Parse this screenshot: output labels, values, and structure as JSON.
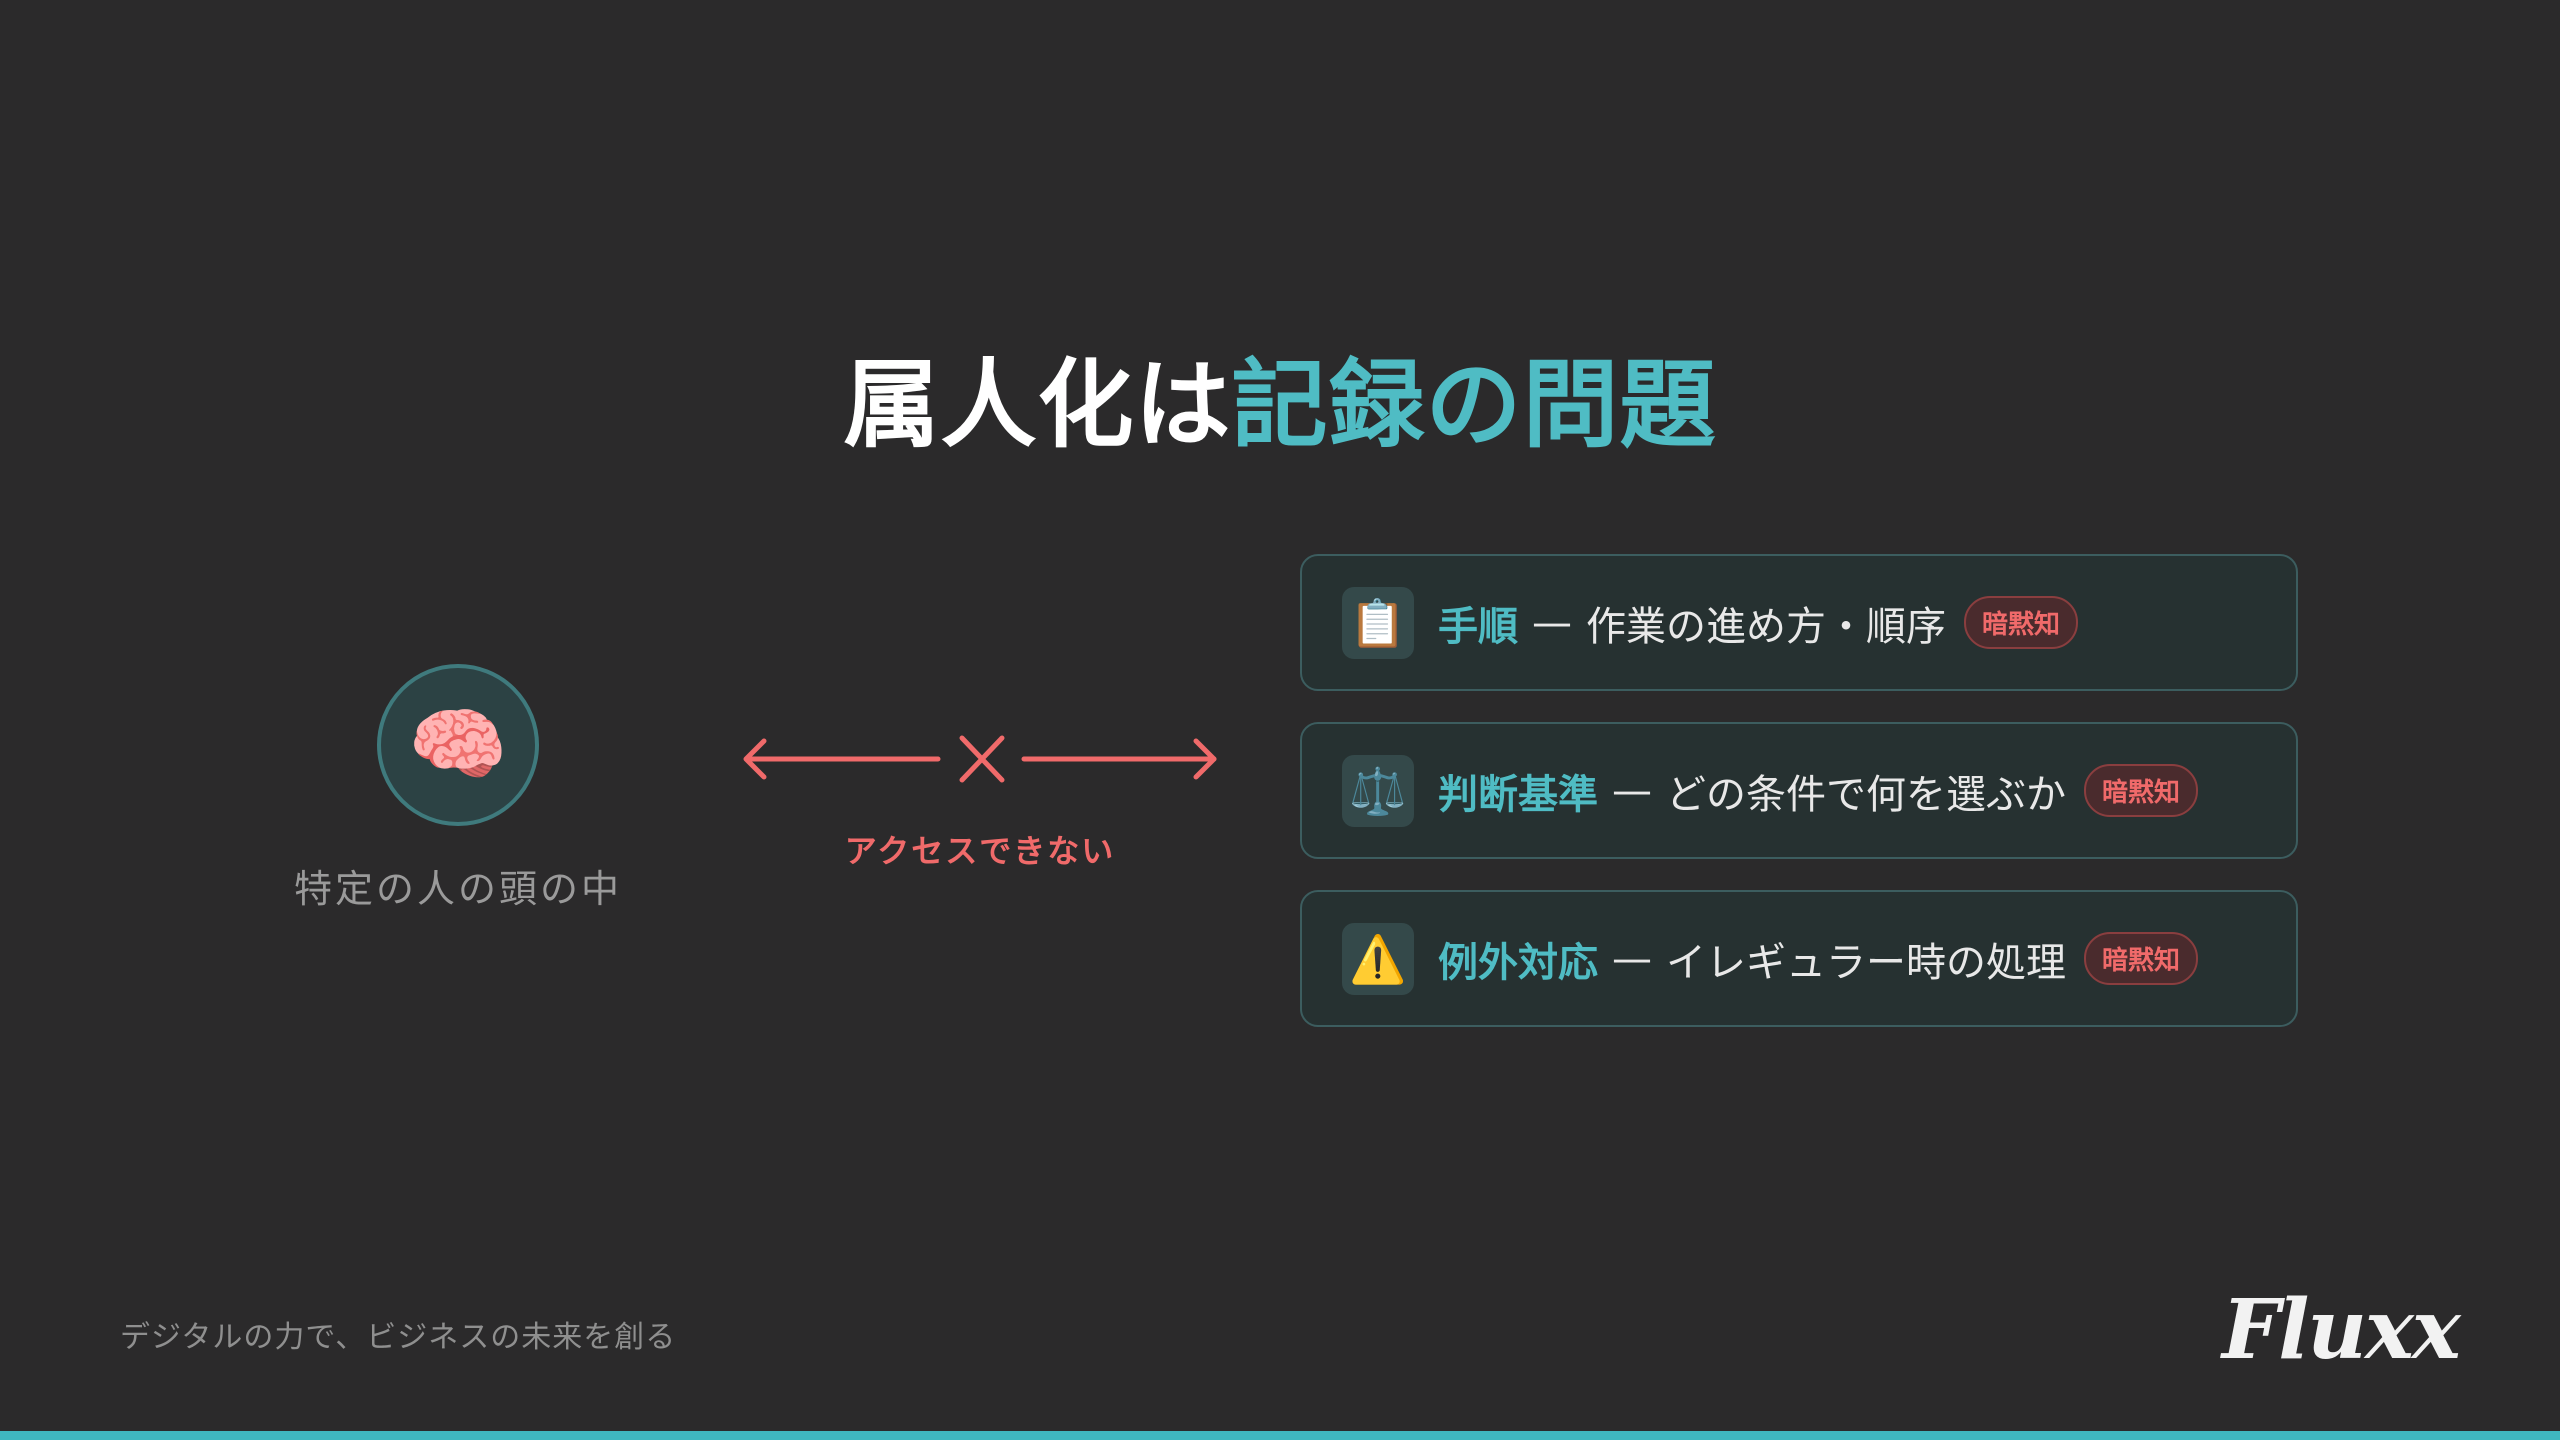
{
  "slide": {
    "title_plain": "属人化は",
    "title_accent": "記録の問題"
  },
  "brain": {
    "icon": "brain-icon",
    "emoji": "🧠",
    "caption": "特定の人の頭の中"
  },
  "connector": {
    "label": "アクセスできない",
    "color": "#f06a6a"
  },
  "cards": [
    {
      "icon": "clipboard-icon",
      "emoji": "📋",
      "title": "手順",
      "separator": "—",
      "desc": "作業の進め方・順序",
      "badge": "暗黙知"
    },
    {
      "icon": "scales-icon",
      "emoji": "⚖️",
      "title": "判断基準",
      "separator": "—",
      "desc": "どの条件で何を選ぶか",
      "badge": "暗黙知"
    },
    {
      "icon": "warning-icon",
      "emoji": "⚠️",
      "title": "例外対応",
      "separator": "—",
      "desc": "イレギュラー時の処理",
      "badge": "暗黙知"
    }
  ],
  "footer": {
    "tagline": "デジタルの力で、ビジネスの未来を創る",
    "logo": "Fluxx"
  },
  "colors": {
    "background": "#2b2a2b",
    "accent": "#4fbcc4",
    "warning": "#f06a6a"
  }
}
